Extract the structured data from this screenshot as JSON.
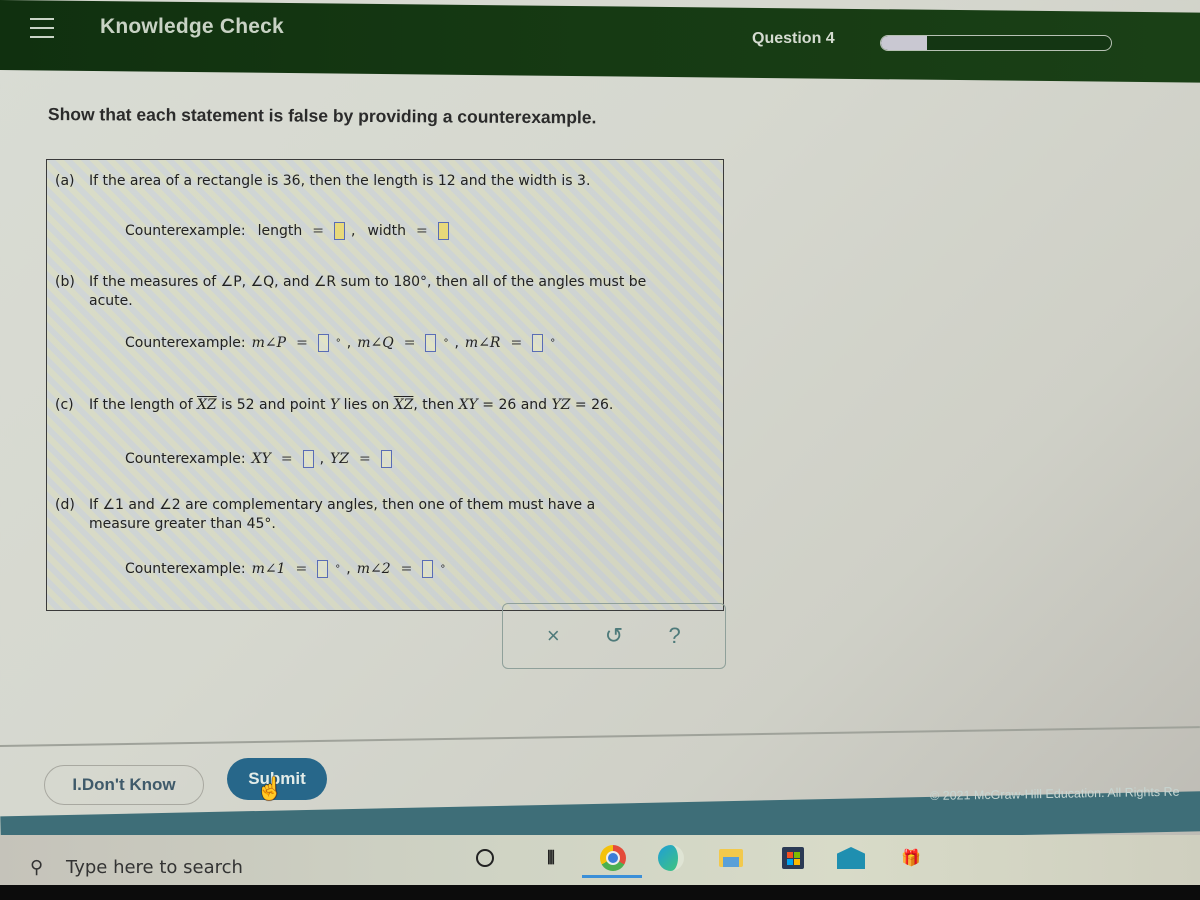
{
  "header": {
    "menu_icon": "hamburger-menu-icon",
    "title": "Knowledge Check",
    "question_label": "Question 4",
    "progress_fraction": 0.2
  },
  "instructions": "Show that each statement is false by providing a counterexample.",
  "parts": [
    {
      "label": "(a)",
      "statement": "If the area of a rectangle is 36, then the length is 12 and the width is 3.",
      "counterexample_label": "Counterexample:",
      "fields": [
        {
          "name": "length",
          "value": "",
          "unit": ""
        },
        {
          "name": "width",
          "value": "",
          "unit": ""
        }
      ]
    },
    {
      "label": "(b)",
      "statement_line1": "If the measures of ∠P, ∠Q, and ∠R sum to 180°, then all of the angles must be",
      "statement_line2": "acute.",
      "counterexample_label": "Counterexample:",
      "fields": [
        {
          "name": "m∠P",
          "value": "",
          "unit": "°"
        },
        {
          "name": "m∠Q",
          "value": "",
          "unit": "°"
        },
        {
          "name": "m∠R",
          "value": "",
          "unit": "°"
        }
      ]
    },
    {
      "label": "(c)",
      "statement_parts": [
        "If the length of ",
        "XZ",
        " is 52 and point ",
        "Y",
        " lies on ",
        "XZ",
        ", then ",
        "XY",
        " = 26 and ",
        "YZ",
        " = 26."
      ],
      "counterexample_label": "Counterexample:",
      "fields": [
        {
          "name": "XY",
          "value": "",
          "unit": ""
        },
        {
          "name": "YZ",
          "value": "",
          "unit": ""
        }
      ]
    },
    {
      "label": "(d)",
      "statement_line1": "If ∠1 and ∠2 are complementary angles, then one of them must have a",
      "statement_line2": "measure greater than 45°.",
      "counterexample_label": "Counterexample:",
      "fields": [
        {
          "name": "m∠1",
          "value": "",
          "unit": "°"
        },
        {
          "name": "m∠2",
          "value": "",
          "unit": "°"
        }
      ]
    }
  ],
  "tools": {
    "clear_icon": "×",
    "undo_icon": "↺",
    "help_icon": "?"
  },
  "buttons": {
    "dont_know": "I.Don't Know",
    "submit": "Submit"
  },
  "footer": {
    "copyright": "© 2021 McGraw-Hill Education. All Rights Re"
  },
  "taskbar": {
    "search_placeholder": "Type here to search",
    "apps": [
      "cortana",
      "task-view",
      "chrome",
      "edge",
      "file-explorer",
      "microsoft-store",
      "mail",
      "gift"
    ]
  }
}
